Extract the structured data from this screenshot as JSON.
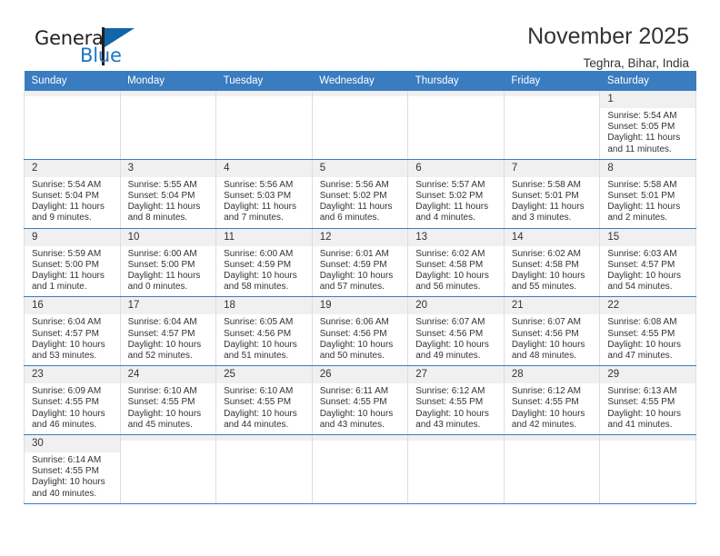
{
  "logo": {
    "word_general": "General",
    "word_blue": "Blue",
    "flag_color": "#1165a8",
    "blue_color": "#1d76c4"
  },
  "header": {
    "title": "November 2025",
    "subtitle": "Teghra, Bihar, India"
  },
  "theme": {
    "header_bg": "#3a7cc0",
    "daynum_bg": "#f0f0f0",
    "row_divider": "#3a7cc0"
  },
  "weekdays": [
    "Sunday",
    "Monday",
    "Tuesday",
    "Wednesday",
    "Thursday",
    "Friday",
    "Saturday"
  ],
  "weeks": [
    [
      {
        "day": "",
        "lines": []
      },
      {
        "day": "",
        "lines": []
      },
      {
        "day": "",
        "lines": []
      },
      {
        "day": "",
        "lines": []
      },
      {
        "day": "",
        "lines": []
      },
      {
        "day": "",
        "lines": []
      },
      {
        "day": "1",
        "lines": [
          "Sunrise: 5:54 AM",
          "Sunset: 5:05 PM",
          "Daylight: 11 hours",
          "and 11 minutes."
        ]
      }
    ],
    [
      {
        "day": "2",
        "lines": [
          "Sunrise: 5:54 AM",
          "Sunset: 5:04 PM",
          "Daylight: 11 hours",
          "and 9 minutes."
        ]
      },
      {
        "day": "3",
        "lines": [
          "Sunrise: 5:55 AM",
          "Sunset: 5:04 PM",
          "Daylight: 11 hours",
          "and 8 minutes."
        ]
      },
      {
        "day": "4",
        "lines": [
          "Sunrise: 5:56 AM",
          "Sunset: 5:03 PM",
          "Daylight: 11 hours",
          "and 7 minutes."
        ]
      },
      {
        "day": "5",
        "lines": [
          "Sunrise: 5:56 AM",
          "Sunset: 5:02 PM",
          "Daylight: 11 hours",
          "and 6 minutes."
        ]
      },
      {
        "day": "6",
        "lines": [
          "Sunrise: 5:57 AM",
          "Sunset: 5:02 PM",
          "Daylight: 11 hours",
          "and 4 minutes."
        ]
      },
      {
        "day": "7",
        "lines": [
          "Sunrise: 5:58 AM",
          "Sunset: 5:01 PM",
          "Daylight: 11 hours",
          "and 3 minutes."
        ]
      },
      {
        "day": "8",
        "lines": [
          "Sunrise: 5:58 AM",
          "Sunset: 5:01 PM",
          "Daylight: 11 hours",
          "and 2 minutes."
        ]
      }
    ],
    [
      {
        "day": "9",
        "lines": [
          "Sunrise: 5:59 AM",
          "Sunset: 5:00 PM",
          "Daylight: 11 hours",
          "and 1 minute."
        ]
      },
      {
        "day": "10",
        "lines": [
          "Sunrise: 6:00 AM",
          "Sunset: 5:00 PM",
          "Daylight: 11 hours",
          "and 0 minutes."
        ]
      },
      {
        "day": "11",
        "lines": [
          "Sunrise: 6:00 AM",
          "Sunset: 4:59 PM",
          "Daylight: 10 hours",
          "and 58 minutes."
        ]
      },
      {
        "day": "12",
        "lines": [
          "Sunrise: 6:01 AM",
          "Sunset: 4:59 PM",
          "Daylight: 10 hours",
          "and 57 minutes."
        ]
      },
      {
        "day": "13",
        "lines": [
          "Sunrise: 6:02 AM",
          "Sunset: 4:58 PM",
          "Daylight: 10 hours",
          "and 56 minutes."
        ]
      },
      {
        "day": "14",
        "lines": [
          "Sunrise: 6:02 AM",
          "Sunset: 4:58 PM",
          "Daylight: 10 hours",
          "and 55 minutes."
        ]
      },
      {
        "day": "15",
        "lines": [
          "Sunrise: 6:03 AM",
          "Sunset: 4:57 PM",
          "Daylight: 10 hours",
          "and 54 minutes."
        ]
      }
    ],
    [
      {
        "day": "16",
        "lines": [
          "Sunrise: 6:04 AM",
          "Sunset: 4:57 PM",
          "Daylight: 10 hours",
          "and 53 minutes."
        ]
      },
      {
        "day": "17",
        "lines": [
          "Sunrise: 6:04 AM",
          "Sunset: 4:57 PM",
          "Daylight: 10 hours",
          "and 52 minutes."
        ]
      },
      {
        "day": "18",
        "lines": [
          "Sunrise: 6:05 AM",
          "Sunset: 4:56 PM",
          "Daylight: 10 hours",
          "and 51 minutes."
        ]
      },
      {
        "day": "19",
        "lines": [
          "Sunrise: 6:06 AM",
          "Sunset: 4:56 PM",
          "Daylight: 10 hours",
          "and 50 minutes."
        ]
      },
      {
        "day": "20",
        "lines": [
          "Sunrise: 6:07 AM",
          "Sunset: 4:56 PM",
          "Daylight: 10 hours",
          "and 49 minutes."
        ]
      },
      {
        "day": "21",
        "lines": [
          "Sunrise: 6:07 AM",
          "Sunset: 4:56 PM",
          "Daylight: 10 hours",
          "and 48 minutes."
        ]
      },
      {
        "day": "22",
        "lines": [
          "Sunrise: 6:08 AM",
          "Sunset: 4:55 PM",
          "Daylight: 10 hours",
          "and 47 minutes."
        ]
      }
    ],
    [
      {
        "day": "23",
        "lines": [
          "Sunrise: 6:09 AM",
          "Sunset: 4:55 PM",
          "Daylight: 10 hours",
          "and 46 minutes."
        ]
      },
      {
        "day": "24",
        "lines": [
          "Sunrise: 6:10 AM",
          "Sunset: 4:55 PM",
          "Daylight: 10 hours",
          "and 45 minutes."
        ]
      },
      {
        "day": "25",
        "lines": [
          "Sunrise: 6:10 AM",
          "Sunset: 4:55 PM",
          "Daylight: 10 hours",
          "and 44 minutes."
        ]
      },
      {
        "day": "26",
        "lines": [
          "Sunrise: 6:11 AM",
          "Sunset: 4:55 PM",
          "Daylight: 10 hours",
          "and 43 minutes."
        ]
      },
      {
        "day": "27",
        "lines": [
          "Sunrise: 6:12 AM",
          "Sunset: 4:55 PM",
          "Daylight: 10 hours",
          "and 43 minutes."
        ]
      },
      {
        "day": "28",
        "lines": [
          "Sunrise: 6:12 AM",
          "Sunset: 4:55 PM",
          "Daylight: 10 hours",
          "and 42 minutes."
        ]
      },
      {
        "day": "29",
        "lines": [
          "Sunrise: 6:13 AM",
          "Sunset: 4:55 PM",
          "Daylight: 10 hours",
          "and 41 minutes."
        ]
      }
    ],
    [
      {
        "day": "30",
        "lines": [
          "Sunrise: 6:14 AM",
          "Sunset: 4:55 PM",
          "Daylight: 10 hours",
          "and 40 minutes."
        ]
      },
      {
        "day": "",
        "lines": []
      },
      {
        "day": "",
        "lines": []
      },
      {
        "day": "",
        "lines": []
      },
      {
        "day": "",
        "lines": []
      },
      {
        "day": "",
        "lines": []
      },
      {
        "day": "",
        "lines": []
      }
    ]
  ]
}
